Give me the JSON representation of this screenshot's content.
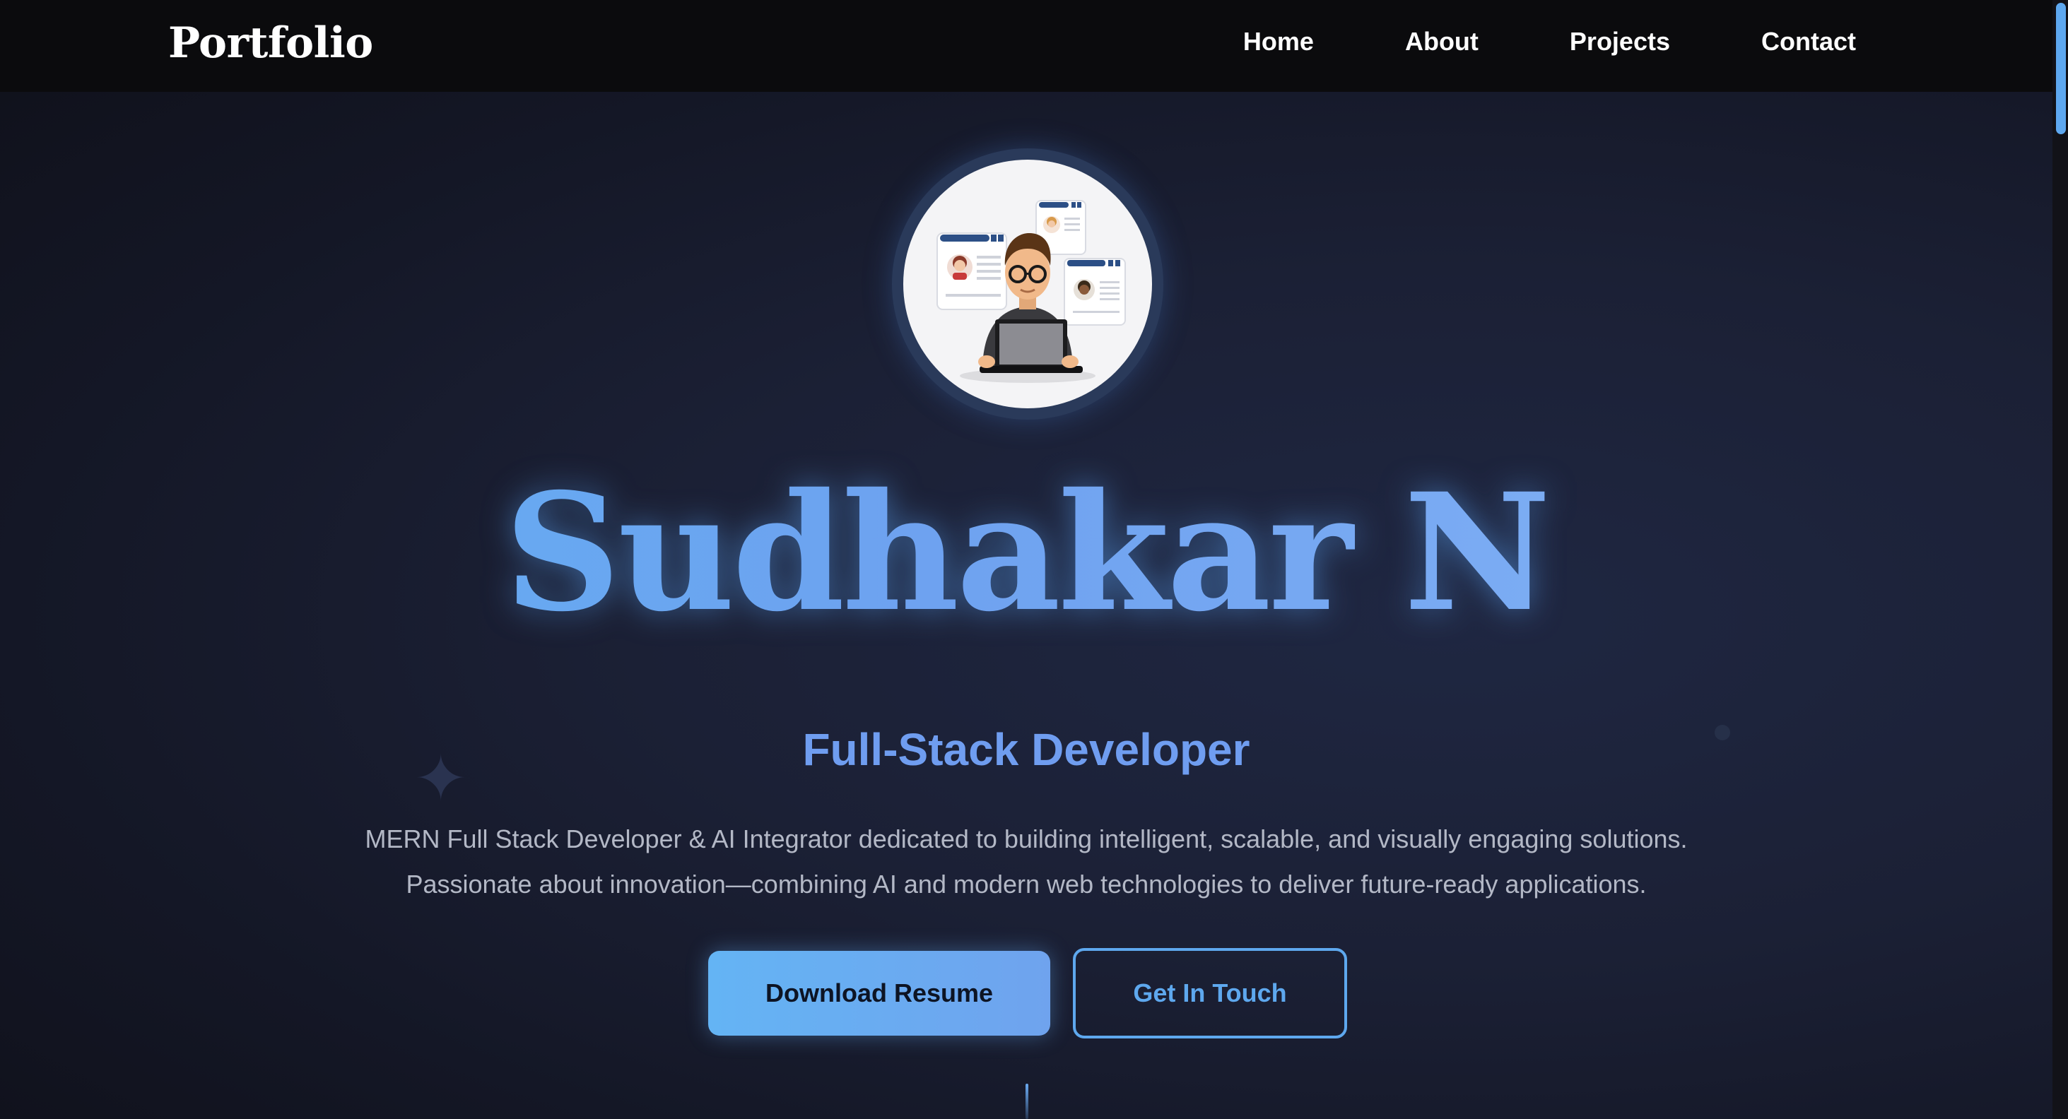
{
  "nav": {
    "brand": "Portfolio",
    "links": [
      "Home",
      "About",
      "Projects",
      "Contact"
    ]
  },
  "hero": {
    "name": "Sudhakar N",
    "role": "Full-Stack Developer",
    "description_line1": "MERN Full Stack Developer & AI Integrator dedicated to building intelligent, scalable, and visually engaging solutions.",
    "description_line2": "Passionate about innovation—combining AI and modern web technologies to deliver future-ready applications."
  },
  "buttons": {
    "primary": "Download Resume",
    "secondary": "Get In Touch"
  },
  "icons": {
    "avatar": "developer-at-laptop-illustration",
    "sparkle": "four-point-star-icon"
  },
  "colors": {
    "accent": "#6aaaf2",
    "nav_bg": "#0b0b0d",
    "page_bg": "#1b2035"
  }
}
